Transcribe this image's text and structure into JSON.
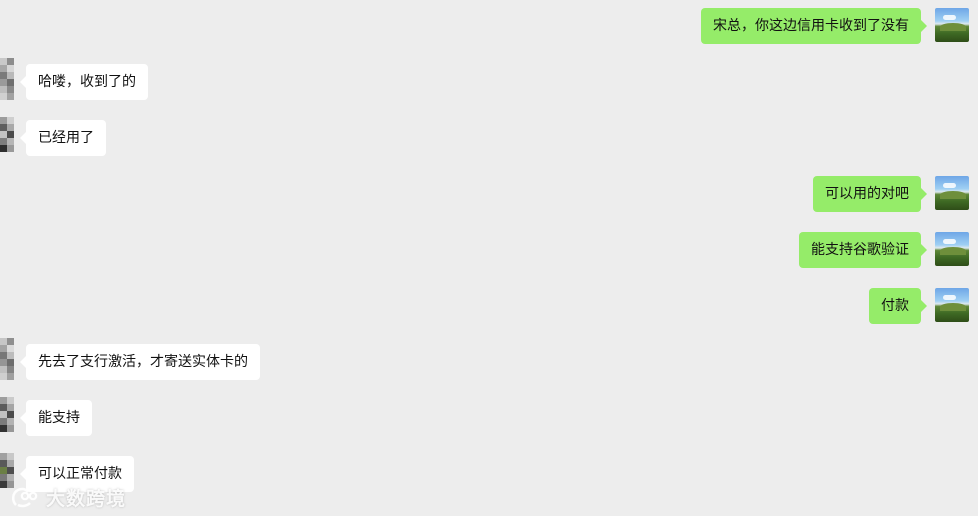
{
  "messages": [
    {
      "from": "me",
      "text": "宋总，你这边信用卡收到了没有"
    },
    {
      "from": "them",
      "text": "哈喽，收到了的"
    },
    {
      "from": "them",
      "text": "已经用了"
    },
    {
      "from": "me",
      "text": "可以用的对吧"
    },
    {
      "from": "me",
      "text": "能支持谷歌验证"
    },
    {
      "from": "me",
      "text": "付款"
    },
    {
      "from": "them",
      "text": "先去了支行激活，才寄送实体卡的"
    },
    {
      "from": "them",
      "text": "能支持"
    },
    {
      "from": "them",
      "text": "可以正常付款"
    }
  ],
  "watermark": {
    "text": "大数跨境"
  },
  "colors": {
    "background": "#ededed",
    "my_bubble": "#95ec69",
    "their_bubble": "#ffffff"
  }
}
